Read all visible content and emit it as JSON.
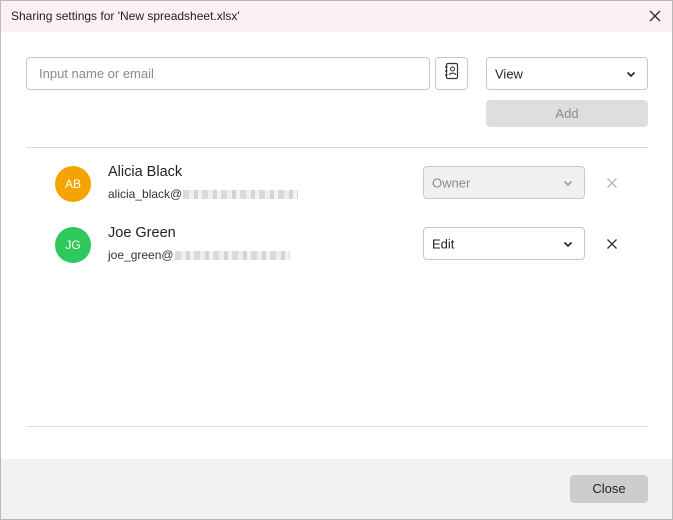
{
  "dialog": {
    "title": "Sharing settings for 'New spreadsheet.xlsx'",
    "close_icon": "close-icon"
  },
  "invite": {
    "placeholder": "Input name or email",
    "contacts_icon": "address-book-icon",
    "permission": "View",
    "add_label": "Add"
  },
  "users": [
    {
      "initials": "AB",
      "name": "Alicia Black",
      "email_prefix": "alicia_black@",
      "avatar_color": "#f5a300",
      "permission": "Owner",
      "permission_disabled": true
    },
    {
      "initials": "JG",
      "name": "Joe Green",
      "email_prefix": "joe_green@",
      "avatar_color": "#2ec95c",
      "permission": "Edit",
      "permission_disabled": false
    }
  ],
  "footer": {
    "close_label": "Close"
  }
}
